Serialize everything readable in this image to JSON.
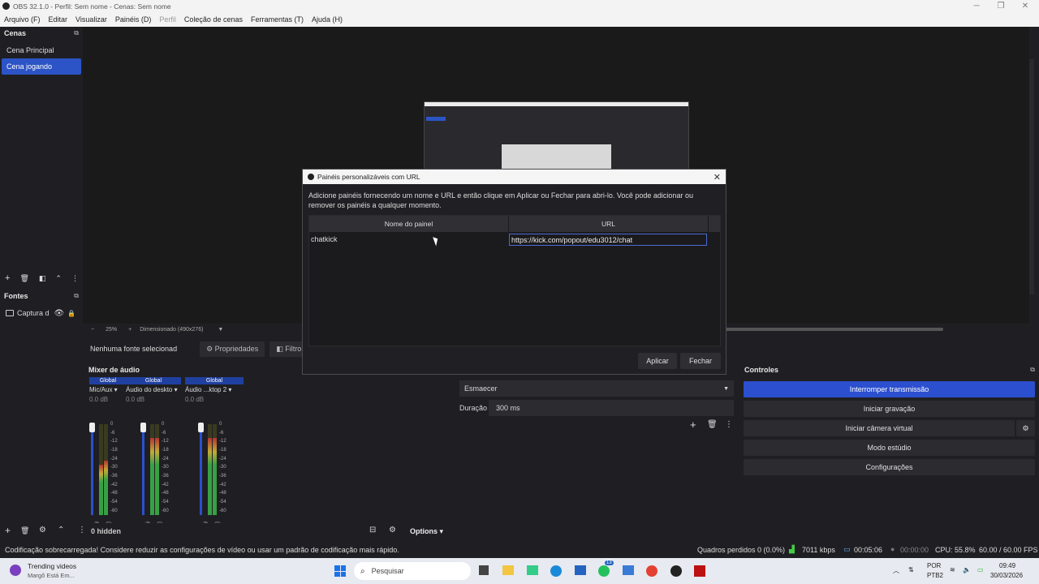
{
  "window": {
    "title": "OBS 32.1.0 - Perfil: Sem nome - Cenas: Sem nome"
  },
  "menu": [
    "Arquivo (F)",
    "Editar",
    "Visualizar",
    "Painéis (D)",
    "Perfil",
    "Coleção de cenas",
    "Ferramentas (T)",
    "Ajuda (H)"
  ],
  "scenes": {
    "title": "Cenas",
    "items": [
      {
        "label": "Cena Principal",
        "active": false
      },
      {
        "label": "Cena jogando",
        "active": true
      }
    ]
  },
  "sources": {
    "title": "Fontes",
    "items": [
      {
        "label": "Captura d"
      }
    ]
  },
  "preview_bar": {
    "zoom": "25%",
    "dimension": "Dimensionado (490x276)"
  },
  "source_toolbar": {
    "no_source": "Nenhuma fonte selecionad",
    "properties": "Propriedades",
    "filters": "Filtro"
  },
  "mixer": {
    "title": "Mixer de áudio",
    "channels": [
      {
        "badge": "Global",
        "name": "Mic/Aux",
        "db": "0.0 dB",
        "level_main": 0.55,
        "level_sec": 0.6
      },
      {
        "badge": "Global",
        "name": "Áudio do deskto",
        "db": "0.0 dB",
        "level_main": 0.85,
        "level_sec": 0.85
      },
      {
        "badge": "Global",
        "name": "Áudio ...ktop 2",
        "db": "0.0 dB",
        "level_main": 0.85,
        "level_sec": 0.85
      }
    ],
    "scale": [
      "0",
      "-6",
      "-12",
      "-18",
      "-24",
      "-30",
      "-36",
      "-42",
      "-48",
      "-54",
      "-60"
    ],
    "hidden": "0 hidden",
    "options": "Options"
  },
  "transitions": {
    "type": "Esmaecer",
    "duration_label": "Duração",
    "duration": "300 ms"
  },
  "controls": {
    "title": "Controles",
    "buttons": [
      "Interromper transmissão",
      "Iniciar gravação",
      "Iniciar câmera virtual",
      "Modo estúdio",
      "Configurações"
    ]
  },
  "dialog": {
    "title": "Painéis personalizáveis com URL",
    "description": "Adicione painéis fornecendo um nome e URL e então clique em Aplicar ou Fechar para abri-lo. Você pode adicionar ou remover os painéis a qualquer momento.",
    "col_name": "Nome do painel",
    "col_url": "URL",
    "rows": [
      {
        "name": "chatkick",
        "url": "https://kick.com/popout/edu3012/chat"
      }
    ],
    "apply": "Aplicar",
    "close": "Fechar"
  },
  "status": {
    "warning": "Codificação sobrecarregada! Considere reduzir as configurações de vídeo ou usar um padrão de codificação mais rápido.",
    "dropped": "Quadros perdidos 0 (0.0%)",
    "bitrate": "7011 kbps",
    "stream_time": "00:05:06",
    "rec_time": "00:00:00",
    "cpu": "CPU: 55.8%",
    "fps": "60.00 / 60.00 FPS"
  },
  "taskbar": {
    "widget_title": "Trending videos",
    "widget_sub": "Margô Está Em...",
    "search": "Pesquisar",
    "lang1": "POR",
    "lang2": "PTB2",
    "time": "09:49",
    "date": "30/03/2026",
    "badge": "13"
  },
  "colors": {
    "accent": "#2c54c6",
    "bg": "#1f1f23"
  }
}
